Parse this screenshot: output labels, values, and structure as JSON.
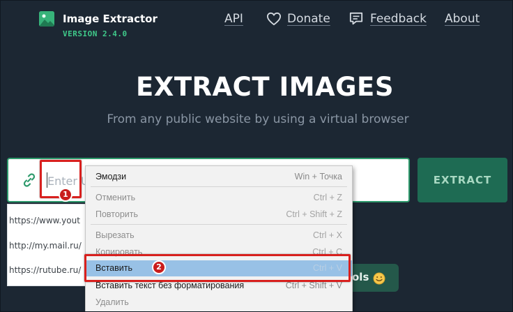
{
  "header": {
    "app_name": "Image Extractor",
    "version": "VERSION 2.4.0",
    "nav": {
      "api": "API",
      "donate": "Donate",
      "feedback": "Feedback",
      "about": "About"
    }
  },
  "hero": {
    "title": "EXTRACT IMAGES",
    "subtitle": "From any public website by using a virtual browser"
  },
  "search": {
    "placeholder": "Enter U",
    "button_label": "EXTRACT"
  },
  "suggestions": [
    "https://www.yout",
    "http://my.mail.ru/",
    "https://rutube.ru/"
  ],
  "tools_pill": {
    "text": "ols"
  },
  "context_menu": {
    "items": [
      {
        "label": "Эмодзи",
        "shortcut": "Win + Точка",
        "state": "enabled"
      },
      {
        "label": "Отменить",
        "shortcut": "Ctrl + Z",
        "state": "disabled"
      },
      {
        "label": "Повторить",
        "shortcut": "Ctrl + Shift + Z",
        "state": "disabled"
      },
      {
        "label": "Вырезать",
        "shortcut": "Ctrl + X",
        "state": "disabled"
      },
      {
        "label": "Копировать",
        "shortcut": "Ctrl + C",
        "state": "disabled"
      },
      {
        "label": "Вставить",
        "shortcut": "Ctrl + V",
        "state": "highlighted"
      },
      {
        "label": "Вставить текст без форматирования",
        "shortcut": "Ctrl + Shift + V",
        "state": "enabled"
      },
      {
        "label": "Удалить",
        "shortcut": "",
        "state": "disabled"
      }
    ]
  },
  "annotations": {
    "step1": "1",
    "step2": "2"
  },
  "colors": {
    "background": "#1c2733",
    "accent": "#3fc98a",
    "button": "#1e6b53",
    "annotation": "#d8201e",
    "menu_highlight": "#98c1e6"
  }
}
